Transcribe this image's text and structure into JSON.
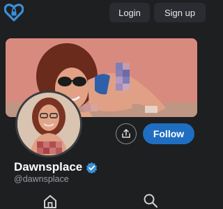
{
  "header": {
    "logo_icon": "heart-lock-logo-icon",
    "login_label": "Login",
    "signup_label": "Sign up"
  },
  "profile": {
    "banner": "profile-banner-image",
    "avatar": "profile-avatar-image",
    "share_icon": "share-icon",
    "follow_label": "Follow",
    "display_name": "Dawnsplace",
    "verified_icon": "verified-badge-icon",
    "handle": "@dawnsplace"
  },
  "bottom_nav": {
    "items": [
      {
        "icon": "home-icon"
      },
      {
        "icon": "search-icon"
      }
    ]
  },
  "colors": {
    "background": "#1d1f21",
    "button_bg": "#2a2c31",
    "accent": "#1f6ec2",
    "logo": "#3b8fd8",
    "muted_text": "#9a9da2"
  }
}
